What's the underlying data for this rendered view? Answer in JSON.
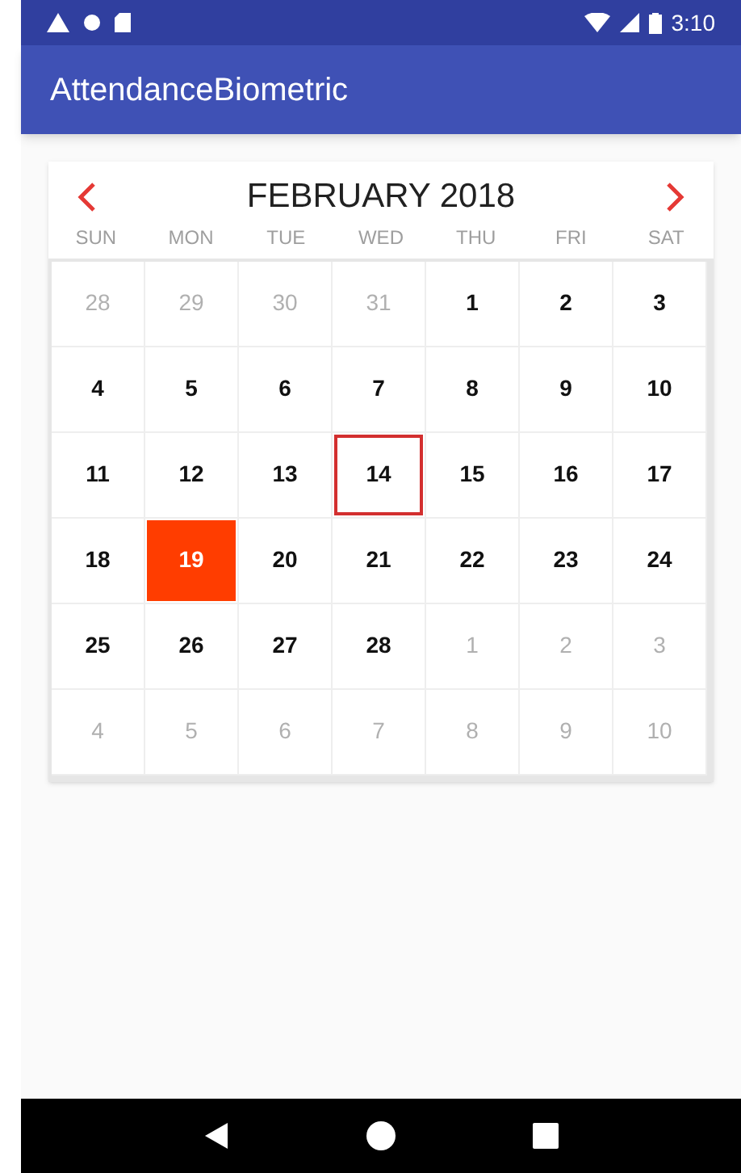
{
  "status_bar": {
    "time": "3:10"
  },
  "app_bar": {
    "title": "AttendanceBiometric"
  },
  "calendar": {
    "month_title": "FEBRUARY 2018",
    "weekdays": [
      "SUN",
      "MON",
      "TUE",
      "WED",
      "THU",
      "FRI",
      "SAT"
    ],
    "days": [
      {
        "label": "28",
        "current_month": false,
        "selected": false,
        "today": false
      },
      {
        "label": "29",
        "current_month": false,
        "selected": false,
        "today": false
      },
      {
        "label": "30",
        "current_month": false,
        "selected": false,
        "today": false
      },
      {
        "label": "31",
        "current_month": false,
        "selected": false,
        "today": false
      },
      {
        "label": "1",
        "current_month": true,
        "selected": false,
        "today": false
      },
      {
        "label": "2",
        "current_month": true,
        "selected": false,
        "today": false
      },
      {
        "label": "3",
        "current_month": true,
        "selected": false,
        "today": false
      },
      {
        "label": "4",
        "current_month": true,
        "selected": false,
        "today": false
      },
      {
        "label": "5",
        "current_month": true,
        "selected": false,
        "today": false
      },
      {
        "label": "6",
        "current_month": true,
        "selected": false,
        "today": false
      },
      {
        "label": "7",
        "current_month": true,
        "selected": false,
        "today": false
      },
      {
        "label": "8",
        "current_month": true,
        "selected": false,
        "today": false
      },
      {
        "label": "9",
        "current_month": true,
        "selected": false,
        "today": false
      },
      {
        "label": "10",
        "current_month": true,
        "selected": false,
        "today": false
      },
      {
        "label": "11",
        "current_month": true,
        "selected": false,
        "today": false
      },
      {
        "label": "12",
        "current_month": true,
        "selected": false,
        "today": false
      },
      {
        "label": "13",
        "current_month": true,
        "selected": false,
        "today": false
      },
      {
        "label": "14",
        "current_month": true,
        "selected": false,
        "today": true
      },
      {
        "label": "15",
        "current_month": true,
        "selected": false,
        "today": false
      },
      {
        "label": "16",
        "current_month": true,
        "selected": false,
        "today": false
      },
      {
        "label": "17",
        "current_month": true,
        "selected": false,
        "today": false
      },
      {
        "label": "18",
        "current_month": true,
        "selected": false,
        "today": false
      },
      {
        "label": "19",
        "current_month": true,
        "selected": true,
        "today": false
      },
      {
        "label": "20",
        "current_month": true,
        "selected": false,
        "today": false
      },
      {
        "label": "21",
        "current_month": true,
        "selected": false,
        "today": false
      },
      {
        "label": "22",
        "current_month": true,
        "selected": false,
        "today": false
      },
      {
        "label": "23",
        "current_month": true,
        "selected": false,
        "today": false
      },
      {
        "label": "24",
        "current_month": true,
        "selected": false,
        "today": false
      },
      {
        "label": "25",
        "current_month": true,
        "selected": false,
        "today": false
      },
      {
        "label": "26",
        "current_month": true,
        "selected": false,
        "today": false
      },
      {
        "label": "27",
        "current_month": true,
        "selected": false,
        "today": false
      },
      {
        "label": "28",
        "current_month": true,
        "selected": false,
        "today": false
      },
      {
        "label": "1",
        "current_month": false,
        "selected": false,
        "today": false
      },
      {
        "label": "2",
        "current_month": false,
        "selected": false,
        "today": false
      },
      {
        "label": "3",
        "current_month": false,
        "selected": false,
        "today": false
      },
      {
        "label": "4",
        "current_month": false,
        "selected": false,
        "today": false
      },
      {
        "label": "5",
        "current_month": false,
        "selected": false,
        "today": false
      },
      {
        "label": "6",
        "current_month": false,
        "selected": false,
        "today": false
      },
      {
        "label": "7",
        "current_month": false,
        "selected": false,
        "today": false
      },
      {
        "label": "8",
        "current_month": false,
        "selected": false,
        "today": false
      },
      {
        "label": "9",
        "current_month": false,
        "selected": false,
        "today": false
      },
      {
        "label": "10",
        "current_month": false,
        "selected": false,
        "today": false
      }
    ]
  }
}
